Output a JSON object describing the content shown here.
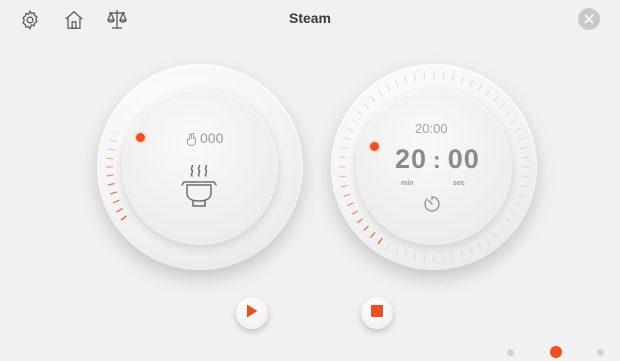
{
  "header": {
    "title": "Steam",
    "icons": [
      "settings-icon",
      "home-icon",
      "scale-icon",
      "close-icon"
    ]
  },
  "steam_dial": {
    "count": "000",
    "icons": [
      "hand-icon",
      "steam-pot-icon"
    ]
  },
  "timer_dial": {
    "set_time": "20:00",
    "minutes": "20",
    "separator": ":",
    "seconds": "00",
    "minutes_unit": "min",
    "seconds_unit": "sec",
    "icons": [
      "timer-icon"
    ]
  },
  "controls": {
    "play_icon": "play-icon",
    "stop_icon": "stop-icon"
  },
  "pagination": {
    "pages": 3,
    "active": 2
  },
  "colors": {
    "accent": "#f04d22",
    "background": "#f1f1f1",
    "text": "#8a8a8a"
  }
}
